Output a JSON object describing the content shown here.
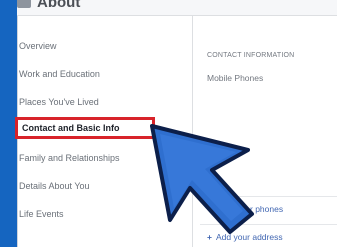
{
  "header": {
    "title": "About"
  },
  "sidebar": {
    "items": [
      {
        "label": "Overview"
      },
      {
        "label": "Work and Education"
      },
      {
        "label": "Places You've Lived"
      },
      {
        "label": "Contact and Basic Info"
      },
      {
        "label": "Family and Relationships"
      },
      {
        "label": "Details About You"
      },
      {
        "label": "Life Events"
      }
    ]
  },
  "contact": {
    "section_title": "CONTACT INFORMATION",
    "mobile_label": "Mobile Phones",
    "add_phones": "Add other phones",
    "add_address": "Add your address"
  },
  "colors": {
    "background": "#1565c0",
    "highlight_box": "#d8232a",
    "arrow_fill": "#2f6fcf",
    "link": "#4267b2"
  }
}
